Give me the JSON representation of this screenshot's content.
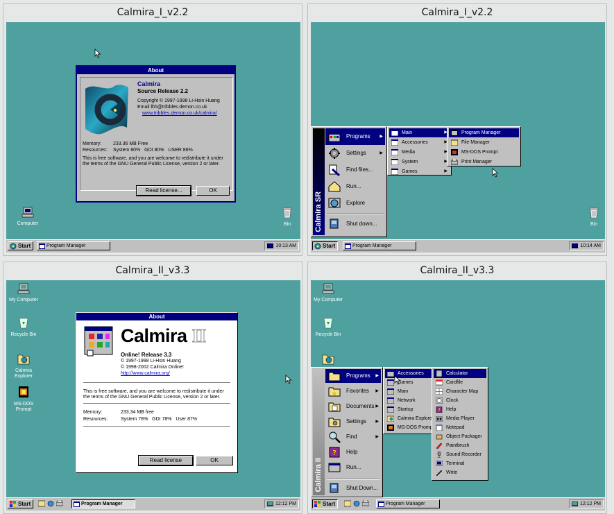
{
  "panels": [
    {
      "title": "Calmira_I_v2.2",
      "about": {
        "title": "About",
        "app_name": "Calmira",
        "release": "Source Release 2.2",
        "copyright": "Copyright © 1997-1998 Li-Hsin Huang",
        "email": "Email lhh@tribbles.demon.co.uk",
        "url": "www.tribbles.demon.co.uk/calmira/",
        "memory_label": "Memory:",
        "memory_value": "233.36 MB Free",
        "resources_label": "Resources:",
        "resources_value": "System 80%   GDI 80%   USER 86%",
        "license": "This is free software, and you are welcome to redistribute it under the terms of the GNU General Public License, version 2 or later.",
        "read_license": "Read license...",
        "ok": "OK"
      },
      "icons": {
        "computer": "Computer",
        "bin": "Bin"
      },
      "taskbar": {
        "start": "Start",
        "task": "Program Manager",
        "clock": "10:13 AM"
      }
    },
    {
      "title": "Calmira_I_v2.2",
      "start_band": "Calmira SR",
      "start_menu": [
        "Programs",
        "Settings",
        "Find files...",
        "Run...",
        "Explore",
        "Shut down..."
      ],
      "programs_menu": [
        "Main",
        "Accessories",
        "Media",
        "System",
        "Games"
      ],
      "main_menu": [
        "Program Manager",
        "File Manager",
        "MS-DOS Prompt",
        "Print Manager"
      ],
      "icons": {
        "bin": "Bin"
      },
      "taskbar": {
        "start": "Start",
        "task": "Program Manager",
        "clock": "10:14 AM"
      }
    },
    {
      "title": "Calmira_II_v3.3",
      "about": {
        "title": "About",
        "app_name": "Calmira",
        "app_suffix": "II",
        "release": "Online! Release 3.3",
        "copyright1": "© 1997-1998 Li-Hsin Huang",
        "copyright2": "© 1998-2002 Calmira Online!",
        "url": "http://www.calmira.org/",
        "license": "This is free software, and you are welcome to redistribute it under the terms of the GNU General Public License, version 2 or later.",
        "memory_label": "Memory:",
        "memory_value": "233.34 MB free",
        "resources_label": "Resources:",
        "resources_value": "System 78%   GDI 78%   User 87%",
        "read_license": "Read license",
        "ok": "OK"
      },
      "icons": {
        "my_computer": "My Computer",
        "recycle_bin": "Recycle Bin",
        "calmira_explorer": "Calmira Explorer",
        "ms_dos_prompt": "MS-DOS Prompt"
      },
      "taskbar": {
        "start": "Start",
        "task": "Program Manager",
        "clock": "12:12 PM"
      }
    },
    {
      "title": "Calmira_II_v3.3",
      "start_band": "Calmira II",
      "start_menu": [
        "Programs",
        "Favorites",
        "Documents",
        "Settings",
        "Find",
        "Help",
        "Run...",
        "Shut Down..."
      ],
      "programs_menu": [
        "Accessories",
        "Games",
        "Main",
        "Network",
        "Startup",
        "Calmira Explorer",
        "MS-DOS Prompt"
      ],
      "accessories_menu": [
        "Calculator",
        "Cardfile",
        "Character Map",
        "Clock",
        "Help",
        "Media Player",
        "Notepad",
        "Object Packager",
        "Paintbrush",
        "Sound Recorder",
        "Terminal",
        "Write"
      ],
      "icons": {
        "my_computer": "My Computer",
        "recycle_bin": "Recycle Bin"
      },
      "taskbar": {
        "start": "Start",
        "task": "Program Manager",
        "clock": "12:12 PM"
      }
    }
  ],
  "colors": {
    "desktop": "#4fa19f",
    "titlebar": "#000080",
    "face": "#c0c0c0"
  }
}
